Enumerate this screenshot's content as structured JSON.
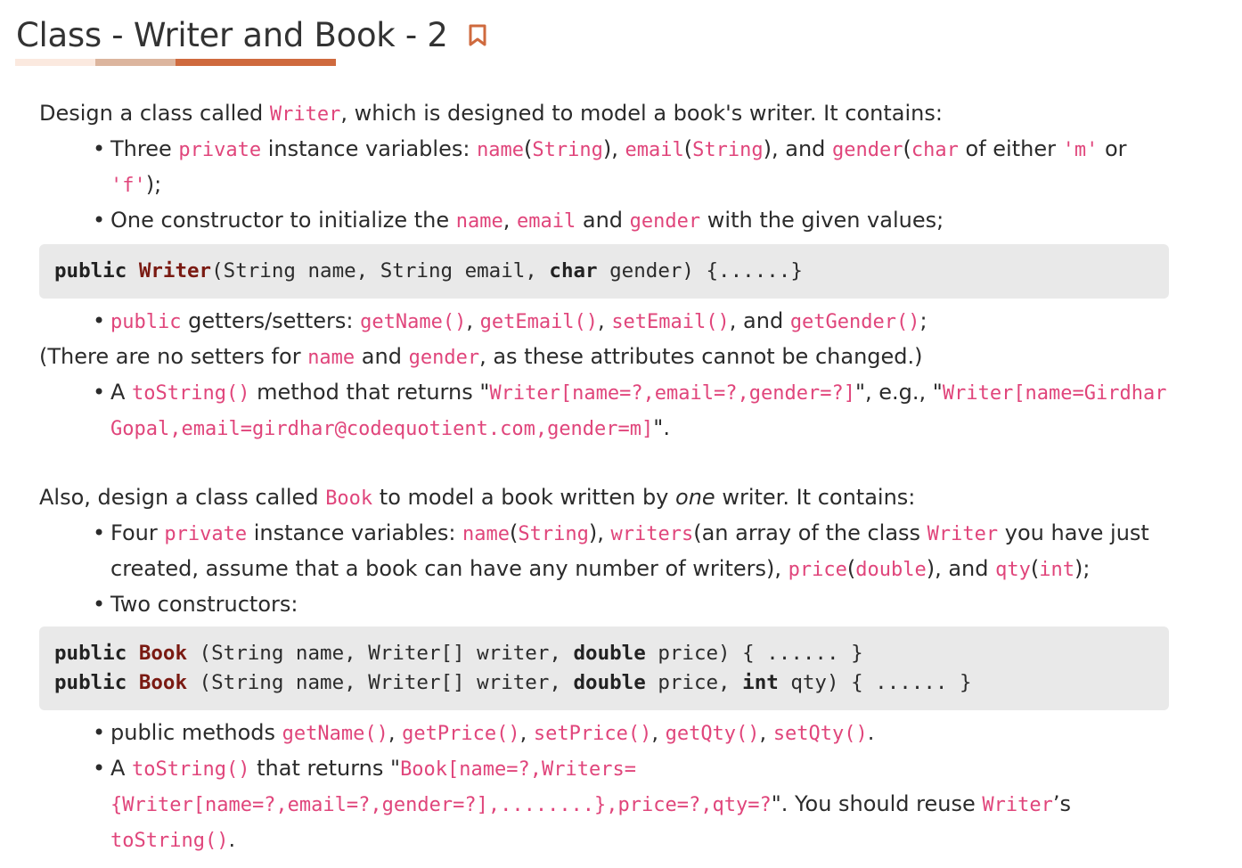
{
  "header": {
    "title": "Class - Writer and Book - 2",
    "bookmark_icon": "bookmark-icon",
    "underline_colors": [
      "#fbe9df",
      "#dcb59e",
      "#cf6a3e",
      "#cf6a3e"
    ]
  },
  "section1": {
    "intro": {
      "t1": "Design a class called ",
      "c1": "Writer",
      "t2": ", which is designed to model a book's writer. It contains:"
    },
    "b1": {
      "t1": "Three ",
      "c1": "private",
      "t2": " instance variables: ",
      "c2": "name",
      "t3": "(",
      "c3": "String",
      "t4": "), ",
      "c4": "email",
      "t5": "(",
      "c5": "String",
      "t6": "), and ",
      "c6": "gender",
      "t7": "(",
      "c7": "char",
      "t8": " of either ",
      "c8": "'m'",
      "t9": " or ",
      "c9": "'f'",
      "t10": ");"
    },
    "b2": {
      "t1": "One constructor to initialize the ",
      "c1": "name",
      "t2": ", ",
      "c2": "email",
      "t3": " and ",
      "c3": "gender",
      "t4": " with the given values;"
    },
    "code": {
      "k1": "public",
      "c1": "Writer",
      "p1": "(String name, String email, ",
      "k2": "char",
      "p2": " gender) {......}"
    },
    "b3": {
      "c1": "public",
      "t1": " getters/setters: ",
      "c2": "getName()",
      "t2": ", ",
      "c3": "getEmail()",
      "t3": ", ",
      "c4": "setEmail()",
      "t4": ", and ",
      "c5": "getGender()",
      "t5": ";"
    },
    "note": {
      "t1": "(There are no setters for ",
      "c1": "name",
      "t2": " and ",
      "c2": "gender",
      "t3": ", as these attributes cannot be changed.)"
    },
    "b4": {
      "t1": "A ",
      "c1": "toString()",
      "t2": " method that returns \"",
      "c2": "Writer[name=?,email=?,gender=?]",
      "t3": "\", e.g., \"",
      "c3": "Writer[name=Girdhar Gopal,email=girdhar@codequotient.com,gender=m]",
      "t4": "\"."
    }
  },
  "section2": {
    "intro": {
      "t1": "Also, design a class called ",
      "c1": "Book",
      "t2": " to model a book written by ",
      "em": "one",
      "t3": " writer. It contains:"
    },
    "b1": {
      "t1": "Four ",
      "c1": "private",
      "t2": " instance variables: ",
      "c2": "name",
      "t3": "(",
      "c3": "String",
      "t4": "), ",
      "c4": "writers",
      "t5": "(an array of the class ",
      "c5": "Writer",
      "t6": " you have just created, assume that a book can have any number of writers), ",
      "c6": "price",
      "t7": "(",
      "c7": "double",
      "t8": "), and ",
      "c8": "qty",
      "t9": "(",
      "c9": "int",
      "t10": ");"
    },
    "b2": {
      "t1": "Two constructors:"
    },
    "code1": {
      "k1": "public",
      "c1": "Book",
      "p1": " (String name, Writer[] writer, ",
      "k2": "double",
      "p2": " price) { ...... }"
    },
    "code2": {
      "k1": "public",
      "c1": "Book",
      "p1": " (String name, Writer[] writer, ",
      "k2": "double",
      "p2": " price, ",
      "k3": "int",
      "p3": " qty) { ...... }"
    },
    "b3": {
      "t1": "public methods ",
      "c1": "getName()",
      "t2": ", ",
      "c2": "getPrice()",
      "t3": ", ",
      "c3": "setPrice()",
      "t4": ", ",
      "c4": "getQty()",
      "t5": ", ",
      "c5": "setQty()",
      "t6": "."
    },
    "b4": {
      "t1": "A ",
      "c1": "toString()",
      "t2": " that returns \"",
      "c2": "Book[name=?,Writers=",
      "c3": "{Writer[name=?,email=?,gender=?],........},price=?,qty=?",
      "t3": "\". You should reuse ",
      "c4": "Writer",
      "t4": "’s ",
      "c5": "toString()",
      "t5": "."
    }
  }
}
